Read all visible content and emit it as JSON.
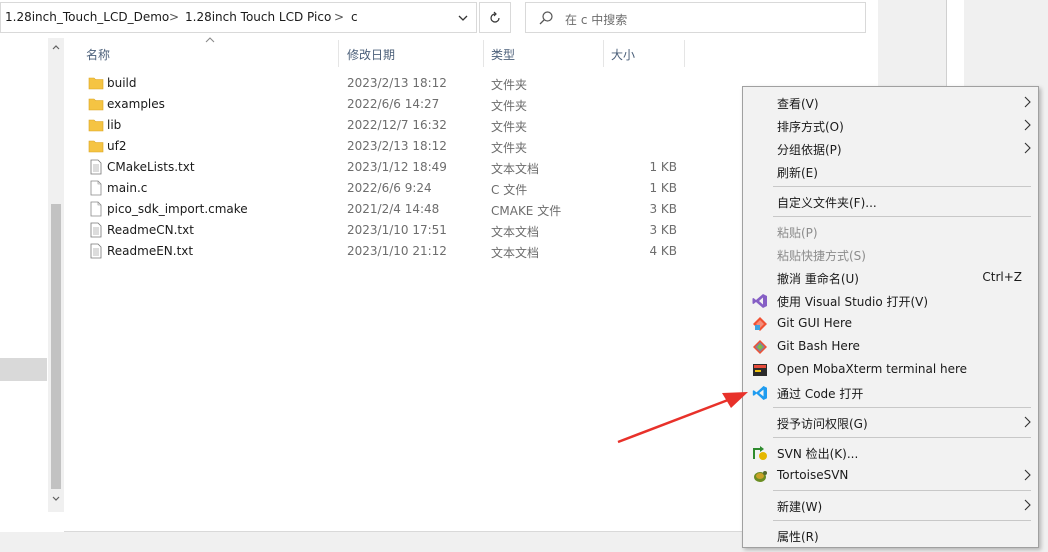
{
  "address": {
    "crumbs": [
      "1.28inch_Touch_LCD_Demo",
      "1.28inch Touch LCD Pico",
      "c"
    ],
    "separator": ">"
  },
  "search": {
    "placeholder": "在 c 中搜索"
  },
  "columns": {
    "name": "名称",
    "date": "修改日期",
    "type": "类型",
    "size": "大小"
  },
  "files": [
    {
      "name": "build",
      "date": "2023/2/13 18:12",
      "type": "文件夹",
      "size": "",
      "icon": "folder-icon"
    },
    {
      "name": "examples",
      "date": "2022/6/6 14:27",
      "type": "文件夹",
      "size": "",
      "icon": "folder-icon"
    },
    {
      "name": "lib",
      "date": "2022/12/7 16:32",
      "type": "文件夹",
      "size": "",
      "icon": "folder-icon"
    },
    {
      "name": "uf2",
      "date": "2023/2/13 18:12",
      "type": "文件夹",
      "size": "",
      "icon": "folder-icon"
    },
    {
      "name": "CMakeLists.txt",
      "date": "2023/1/12 18:49",
      "type": "文本文档",
      "size": "1 KB",
      "icon": "text-file-icon"
    },
    {
      "name": "main.c",
      "date": "2022/6/6 9:24",
      "type": "C 文件",
      "size": "1 KB",
      "icon": "c-file-icon"
    },
    {
      "name": "pico_sdk_import.cmake",
      "date": "2021/2/4 14:48",
      "type": "CMAKE 文件",
      "size": "3 KB",
      "icon": "file-icon"
    },
    {
      "name": "ReadmeCN.txt",
      "date": "2023/1/10 17:51",
      "type": "文本文档",
      "size": "3 KB",
      "icon": "text-file-icon"
    },
    {
      "name": "ReadmeEN.txt",
      "date": "2023/1/10 21:12",
      "type": "文本文档",
      "size": "4 KB",
      "icon": "text-file-icon"
    }
  ],
  "context_menu": {
    "view": "查看(V)",
    "sort": "排序方式(O)",
    "group": "分组依据(P)",
    "refresh": "刷新(E)",
    "customize": "自定义文件夹(F)...",
    "paste": "粘贴(P)",
    "paste_shortcut": "粘贴快捷方式(S)",
    "undo_rename": "撤消 重命名(U)",
    "undo_shortcut": "Ctrl+Z",
    "open_vs": "使用 Visual Studio 打开(V)",
    "git_gui": "Git GUI Here",
    "git_bash": "Git Bash Here",
    "mobaxterm": "Open MobaXterm terminal here",
    "open_code": "通过 Code 打开",
    "grant_access": "授予访问权限(G)",
    "svn_checkout": "SVN 检出(K)...",
    "tortoise": "TortoiseSVN",
    "new": "新建(W)",
    "properties": "属性(R)"
  },
  "colors": {
    "folder": "#f5c443",
    "vs_purple": "#865fc5",
    "vscode_blue": "#1f9cf0",
    "arrow_red": "#e8312a"
  }
}
